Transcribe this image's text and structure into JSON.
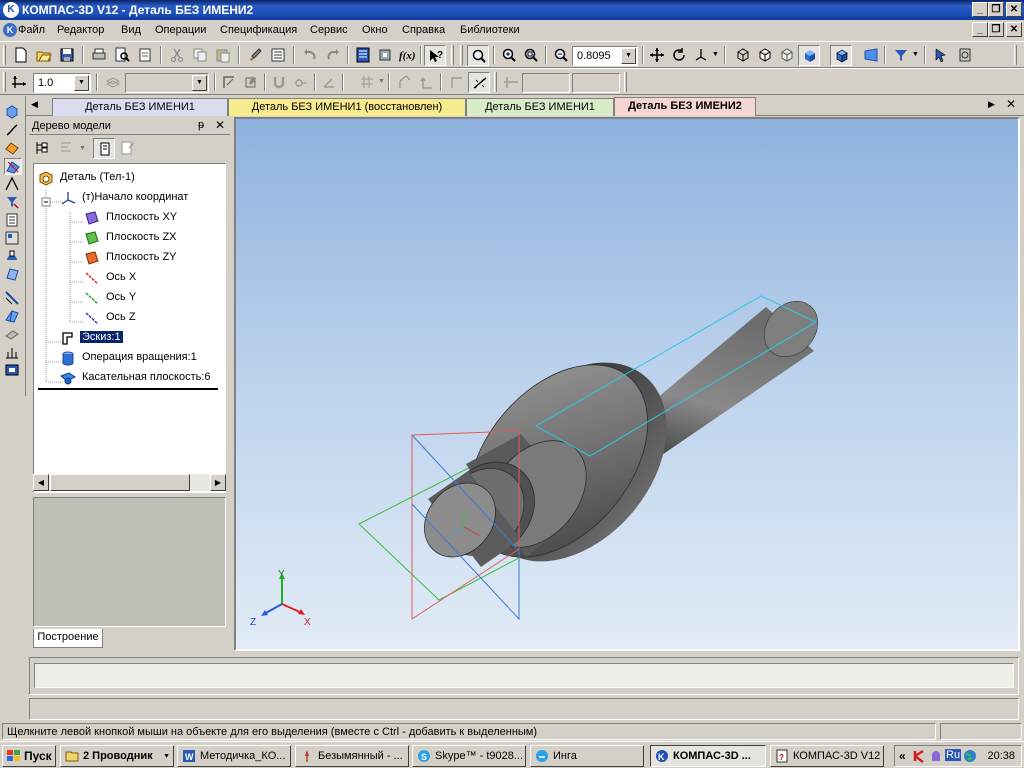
{
  "window": {
    "title": "КОМПАС-3D V12 - Деталь БЕЗ ИМЕНИ2",
    "app_icon": "K",
    "controls": [
      "_",
      "❐",
      "✕"
    ]
  },
  "menu": {
    "items": [
      "Файл",
      "Редактор",
      "Вид",
      "Операции",
      "Спецификация",
      "Сервис",
      "Окно",
      "Справка",
      "Библиотеки"
    ],
    "mdi_controls": [
      "_",
      "❐",
      "✕"
    ]
  },
  "toolbar": {
    "zoom_value": "0.8095",
    "step_value": "1.0"
  },
  "tabs": [
    {
      "label": "Деталь БЕЗ ИМЕНИ1",
      "color": "#dcdcf0"
    },
    {
      "label": "Деталь БЕЗ ИМЕНИ1 (восстановлен)",
      "color": "#f7eb8f"
    },
    {
      "label": "Деталь БЕЗ ИМЕНИ1",
      "color": "#d9ecc9"
    },
    {
      "label": "Деталь БЕЗ ИМЕНИ2",
      "color": "#f6d6d2",
      "active": true
    }
  ],
  "tree_panel": {
    "title": "Дерево модели",
    "pin": "ᵽ",
    "close": "✕",
    "items": [
      {
        "label": "Деталь (Тел-1)",
        "icon": "part-icon"
      },
      {
        "label": "(т)Начало координат",
        "icon": "origin-icon"
      },
      {
        "label": "Плоскость XY",
        "icon": "plane-xy-icon"
      },
      {
        "label": "Плоскость ZX",
        "icon": "plane-zx-icon"
      },
      {
        "label": "Плоскость ZY",
        "icon": "plane-zy-icon"
      },
      {
        "label": "Ось X",
        "icon": "axis-x-icon"
      },
      {
        "label": "Ось Y",
        "icon": "axis-y-icon"
      },
      {
        "label": "Ось Z",
        "icon": "axis-z-icon"
      },
      {
        "label": "Эскиз:1",
        "icon": "sketch-icon",
        "selected": true
      },
      {
        "label": "Операция вращения:1",
        "icon": "revolve-icon"
      },
      {
        "label": "Касательная плоскость:6",
        "icon": "tangent-plane-icon"
      }
    ],
    "collapse_sign": "−",
    "bottom_tab": "Построение"
  },
  "viewport": {
    "axis_labels": {
      "x": "X",
      "y": "Y",
      "z": "Z"
    }
  },
  "statusbar": {
    "text": "Щелкните левой кнопкой мыши на объекте для его выделения (вместе с Ctrl - добавить к выделенным)"
  },
  "taskbar": {
    "start": "Пуск",
    "tasks": [
      {
        "label": "2 Проводник",
        "icon": "folder-icon",
        "dropdown": true
      },
      {
        "label": "Методичка_КО...",
        "icon": "word-icon"
      },
      {
        "label": "Безымянный - ...",
        "icon": "paint-icon"
      },
      {
        "label": "Skype™ - t9028...",
        "icon": "skype-icon"
      },
      {
        "label": "Инга",
        "icon": "chat-icon"
      },
      {
        "label": "КОМПАС-3D ...",
        "icon": "kompas-icon",
        "active": true
      },
      {
        "label": "КОМПАС-3D V12",
        "icon": "kompas-doc-icon"
      }
    ],
    "tray": {
      "expand": "«",
      "lang": "Ru",
      "clock": "20:38"
    }
  }
}
